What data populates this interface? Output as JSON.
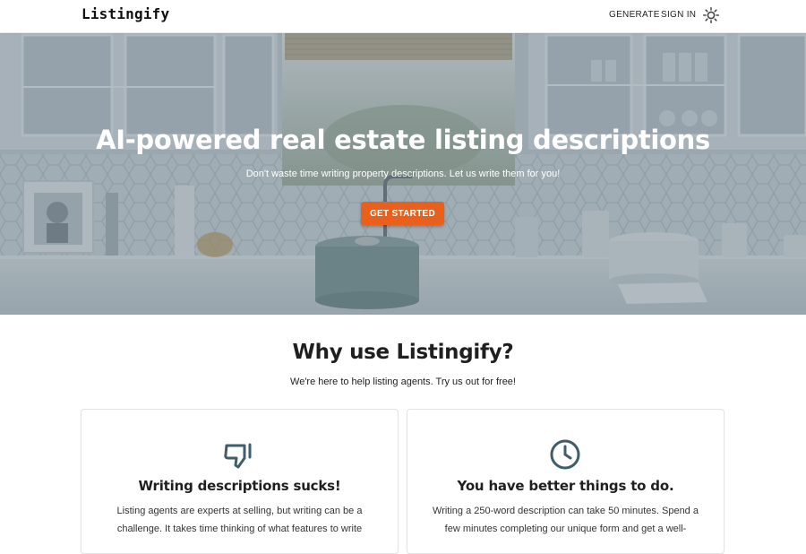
{
  "header": {
    "logo": "Listingify",
    "nav": {
      "generate": "GENERATE",
      "sign_in": "SIGN IN"
    },
    "theme_toggle_icon": "sun-icon"
  },
  "hero": {
    "title": "AI-powered real estate listing descriptions",
    "subtitle": "Don't waste time writing property descriptions. Let us write them for you!",
    "cta_label": "GET STARTED",
    "cta_color": "#e8601c",
    "background": "kitchen-photo"
  },
  "why": {
    "title": "Why use Listingify?",
    "subtitle": "We're here to help listing agents. Try us out for free!",
    "cards": [
      {
        "icon": "thumbs-down-icon",
        "title": "Writing descriptions sucks!",
        "text": "Listing agents are experts at selling, but writing can be a challenge. It takes time thinking of what features to write"
      },
      {
        "icon": "clock-icon",
        "title": "You have better things to do.",
        "text": "Writing a 250-word description can take 50 minutes. Spend a few minutes completing our unique form and get a well-"
      }
    ],
    "icon_color": "#3f5d6c"
  }
}
